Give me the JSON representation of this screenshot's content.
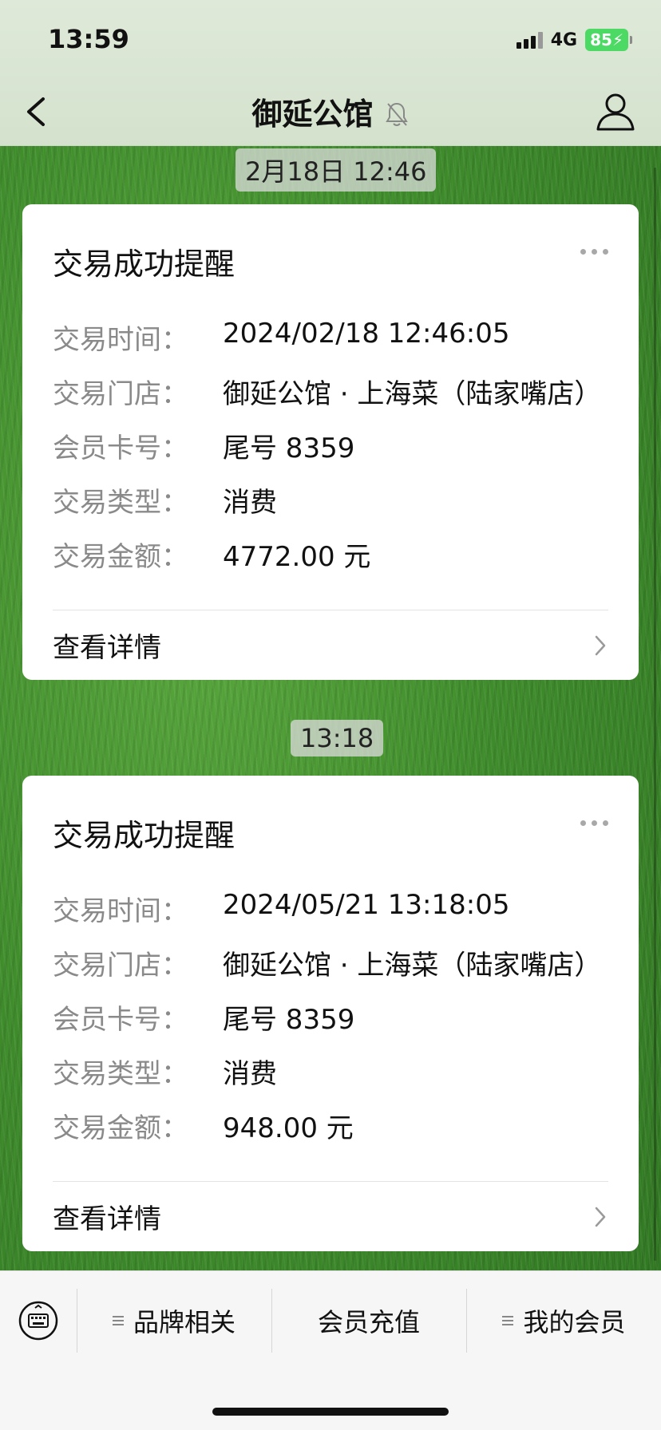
{
  "status_bar": {
    "time": "13:59",
    "network": "4G",
    "battery": "85"
  },
  "header": {
    "title": "御延公馆"
  },
  "messages": [
    {
      "timestamp": "2月18日 12:46",
      "card_title": "交易成功提醒",
      "fields": [
        {
          "label": "交易时间：",
          "value": "2024/02/18 12:46:05"
        },
        {
          "label": "交易门店：",
          "value": "御延公馆 · 上海菜（陆家嘴店）"
        },
        {
          "label": "会员卡号：",
          "value": "尾号 8359"
        },
        {
          "label": "交易类型：",
          "value": "消费"
        },
        {
          "label": "交易金额：",
          "value": "4772.00 元"
        }
      ],
      "detail_label": "查看详情"
    },
    {
      "timestamp": "13:18",
      "card_title": "交易成功提醒",
      "fields": [
        {
          "label": "交易时间：",
          "value": "2024/05/21 13:18:05"
        },
        {
          "label": "交易门店：",
          "value": "御延公馆 · 上海菜（陆家嘴店）"
        },
        {
          "label": "会员卡号：",
          "value": "尾号 8359"
        },
        {
          "label": "交易类型：",
          "value": "消费"
        },
        {
          "label": "交易金额：",
          "value": "948.00 元"
        }
      ],
      "detail_label": "查看详情"
    }
  ],
  "bottom_menu": {
    "items": [
      {
        "label": "品牌相关"
      },
      {
        "label": "会员充值"
      },
      {
        "label": "我的会员"
      }
    ]
  },
  "icons": [
    "back-icon",
    "mute-bell-icon",
    "profile-icon",
    "more-icon",
    "chevron-right-icon",
    "keyboard-icon",
    "menu-icon"
  ]
}
